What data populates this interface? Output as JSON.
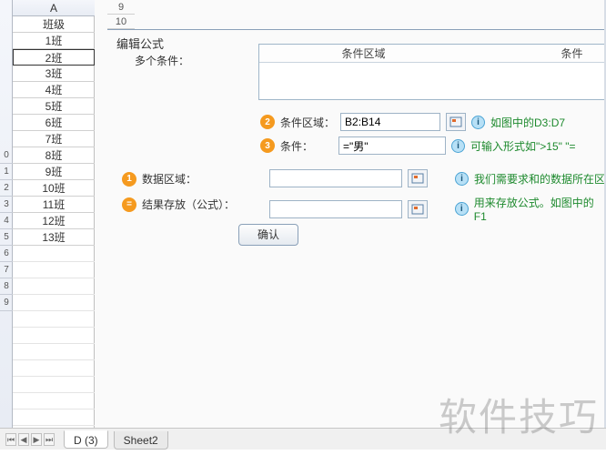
{
  "left": {
    "col_header": "A",
    "row_numbers": [
      "",
      "0",
      "1",
      "2",
      "3",
      "4",
      "5",
      "6",
      "7",
      "8",
      "9"
    ],
    "class_header": "班级",
    "classes": [
      "1班",
      "2班",
      "3班",
      "4班",
      "5班",
      "6班",
      "7班",
      "8班",
      "9班",
      "10班",
      "11班",
      "12班",
      "13班"
    ]
  },
  "panel": {
    "frag_rows": [
      "9",
      "10"
    ],
    "title": "编辑公式",
    "multi_label": "多个条件：",
    "table": {
      "th1": "条件区域",
      "th2": "条件"
    },
    "row2": {
      "bullet": "2",
      "label": "条件区域：",
      "value": "B2:B14",
      "hint": "如图中的D3:D7"
    },
    "row3": {
      "bullet": "3",
      "label": "条件：",
      "value": "=\"男\"",
      "hint": "可输入形式如\">15\"  \"="
    },
    "row1": {
      "bullet": "1",
      "label": "数据区域：",
      "value": "",
      "hint": "我们需要求和的数据所在区"
    },
    "rowResult": {
      "bullet": "=",
      "label": "结果存放（公式）：",
      "value": "",
      "hint": "用来存放公式。如图中的F1"
    },
    "ok": "确认"
  },
  "tabs": {
    "t1": "D (3)",
    "t2": "Sheet2"
  },
  "watermark": "软件技巧"
}
